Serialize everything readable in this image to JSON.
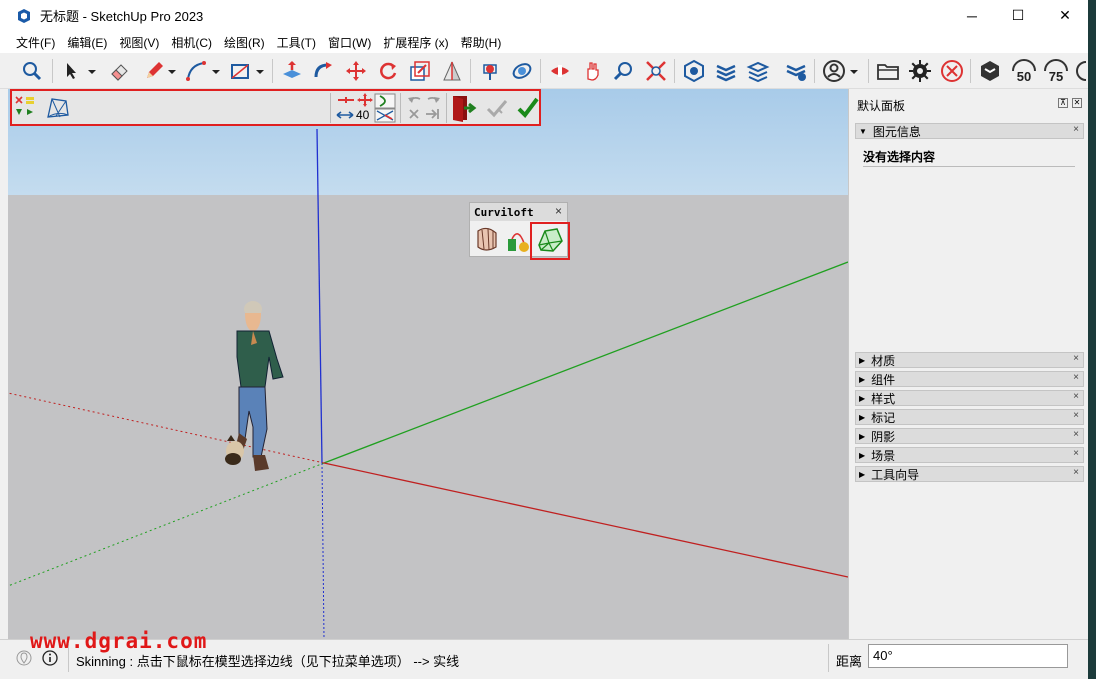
{
  "window": {
    "title": "无标题 - SketchUp Pro 2023",
    "controls": {
      "minimize": "─",
      "maximize": "☐",
      "close": "✕"
    }
  },
  "menu": [
    "文件(F)",
    "编辑(E)",
    "视图(V)",
    "相机(C)",
    "绘图(R)",
    "工具(T)",
    "窗口(W)",
    "扩展程序 (x)",
    "帮助(H)"
  ],
  "toolbar": {
    "icons": [
      "search-icon",
      "select-arrow-icon",
      "eraser-icon",
      "pencil-icon",
      "arc-icon",
      "rectangle-icon",
      "push-pull-icon",
      "follow-me-icon",
      "move-icon",
      "rotate-icon",
      "scale-icon",
      "section-icon",
      "paint-icon",
      "orbit-icon",
      "pan-icon",
      "zoom-icon",
      "zoom-extents-icon",
      "warehouse-icon",
      "layers-icon",
      "stack-icon",
      "sandbox-icon",
      "account-icon",
      "folder-icon",
      "gear-icon",
      "cancel-icon",
      "extension-warehouse-icon",
      "50-icon",
      "75-icon"
    ],
    "labels": {
      "speed_50": "50",
      "speed_75": "75"
    }
  },
  "sub_toolbar": {
    "segment_count": "40"
  },
  "curviloft": {
    "title": "Curviloft",
    "close": "×"
  },
  "panel": {
    "title": "默认面板",
    "entity_info": {
      "header": "图元信息",
      "empty_text": "没有选择内容"
    },
    "trays": [
      "材质",
      "组件",
      "样式",
      "标记",
      "阴影",
      "场景",
      "工具向导"
    ],
    "close_symbol": "×"
  },
  "status": {
    "message": "Skinning : 点击下鼠标在模型选择边线（见下拉菜单选项） --> 实线",
    "vcb_label": "距离",
    "vcb_value": "40°"
  },
  "watermark": "www.dgrai.com",
  "colors": {
    "sky": "#b5d3ed",
    "ground": "#c3c3c5",
    "highlight": "#e02020",
    "axis_red": "#cc2020",
    "axis_green": "#20a020",
    "axis_blue": "#2020d0"
  }
}
